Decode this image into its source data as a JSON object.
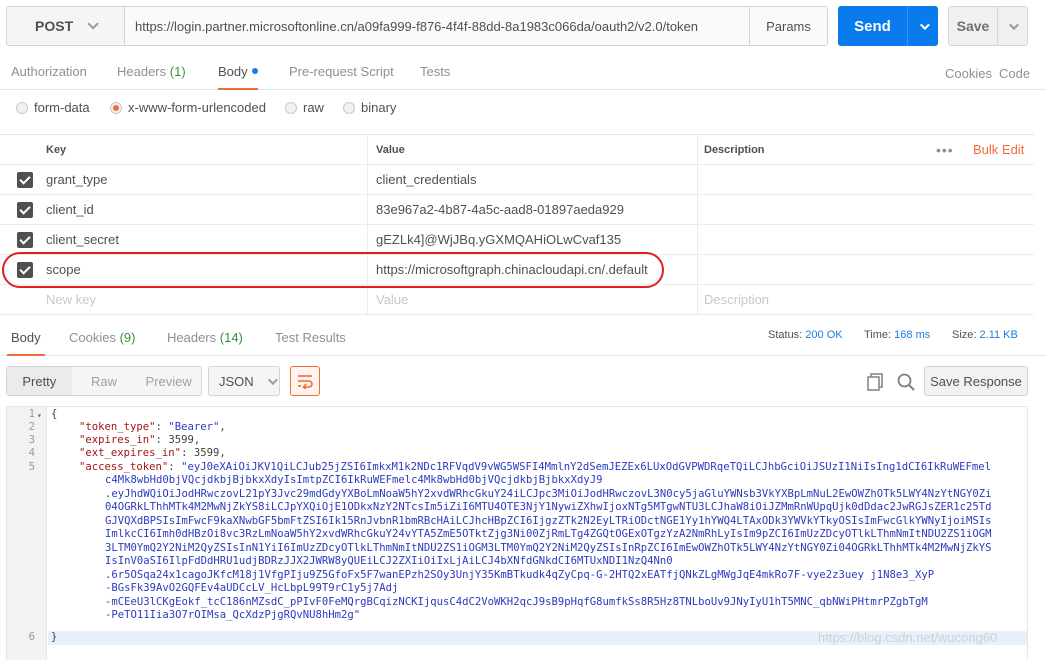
{
  "request": {
    "method": "POST",
    "url": "https://login.partner.microsoftonline.cn/a09fa999-f876-4f4f-88dd-8a1983c066da/oauth2/v2.0/token",
    "params_label": "Params",
    "send_label": "Send",
    "save_label": "Save"
  },
  "req_tabs": {
    "authorization": "Authorization",
    "headers": "Headers",
    "headers_count": "(1)",
    "body": "Body",
    "prerequest": "Pre-request Script",
    "tests": "Tests",
    "cookies": "Cookies",
    "code": "Code"
  },
  "body_types": {
    "form_data": "form-data",
    "urlencoded": "x-www-form-urlencoded",
    "raw": "raw",
    "binary": "binary",
    "selected": "x-www-form-urlencoded"
  },
  "kv_table": {
    "headers": {
      "key": "Key",
      "value": "Value",
      "description": "Description",
      "bulk_edit": "Bulk Edit"
    },
    "rows": [
      {
        "key": "grant_type",
        "value": "client_credentials",
        "checked": true
      },
      {
        "key": "client_id",
        "value": "83e967a2-4b87-4a5c-aad8-01897aeda929",
        "checked": true
      },
      {
        "key": "client_secret",
        "value": "gEZLk4]@WjJBq.yGXMQAHiOLwCvaf135",
        "checked": true
      },
      {
        "key": "scope",
        "value": "https://microsoftgraph.chinacloudapi.cn/.default",
        "checked": true
      }
    ],
    "new_key_placeholder": "New key",
    "value_placeholder": "Value",
    "description_placeholder": "Description"
  },
  "res_tabs": {
    "body": "Body",
    "cookies": "Cookies",
    "cookies_count": "(9)",
    "headers": "Headers",
    "headers_count": "(14)",
    "test_results": "Test Results",
    "status_label": "Status:",
    "status_value": "200 OK",
    "time_label": "Time:",
    "time_value": "168 ms",
    "size_label": "Size:",
    "size_value": "2.11 KB"
  },
  "res_toolbar": {
    "pretty": "Pretty",
    "raw": "Raw",
    "preview": "Preview",
    "format": "JSON",
    "save_response": "Save Response"
  },
  "response": {
    "line_numbers": [
      "1",
      "2",
      "3",
      "4",
      "5",
      "6"
    ],
    "open_brace": "{",
    "close_brace": "}",
    "token_type_key": "\"token_type\"",
    "token_type_val": "\"Bearer\"",
    "expires_in_key": "\"expires_in\"",
    "expires_in_val": "3599",
    "ext_expires_in_key": "\"ext_expires_in\"",
    "ext_expires_in_val": "3599",
    "access_token_key": "\"access_token\"",
    "access_token_lines": [
      "\"eyJ0eXAiOiJKV1QiLCJub25jZSI6ImkxM1k2NDc1RFVqdV9vWG5WSFI4MmlnY2dSemJEZEx6LUxOdGVPWDRqeTQiLCJhbGciOiJSUzI1NiIsIng1dCI6IkRuWEFmel",
      "c4Mk8wbHd0bjVQcjdkbjBjbkxXdyIsImtpZCI6IkRuWEFmelc4Mk8wbHd0bjVQcjdkbjBjbkxXdyJ9",
      ".eyJhdWQiOiJodHRwczovL21pY3Jvc29mdGdyYXBoLmNoaW5hY2xvdWRhcGkuY24iLCJpc3MiOiJodHRwczovL3N0cy5jaGluYWNsb3VkYXBpLmNuL2EwOWZhOTk5LWY4NzYtNGY0Zi",
      "04OGRkLThhMTk4M2MwNjZkYS8iLCJpYXQiOjE1ODkxNzY2NTcsIm5iZiI6MTU4OTE3NjY1NywiZXhwIjoxNTg5MTgwNTU3LCJhaW8iOiJZMmRnWUpqUjk0dDdac2JwRGJsZER1c25Td",
      "GJVQXdBPSIsImFwcF9kaXNwbGF5bmFtZSI6Ik15RnJvbnR1bmRBcHAiLCJhcHBpZCI6IjgzZTk2N2EyLTRiODctNGE1Yy1hYWQ4LTAxODk3YWVkYTkyOSIsImFwcGlkYWNyIjoiMSIs",
      "ImlkcCI6Imh0dHBzOi8vc3RzLmNoaW5hY2xvdWRhcGkuY24vYTA5ZmE5OTktZjg3Ni00ZjRmLTg4ZGQtOGExOTgzYzA2NmRhLyIsIm9pZCI6ImUzZDcyOTlkLThmNmItNDU2ZS1iOGM",
      "3LTM0YmQ2Y2NiM2QyZSIsInN1YiI6ImUzZDcyOTlkLThmNmItNDU2ZS1iOGM3LTM0YmQ2Y2NiM2QyZSIsInRpZCI6ImEwOWZhOTk5LWY4NzYtNGY0Zi04OGRkLThhMTk4M2MwNjZkYS",
      "IsInV0aSI6IlpFdDdHRU1udjBDRzJJX2JWRW8yQUEiLCJ2ZXIiOiIxLjAiLCJ4bXNfdGNkdCI6MTUxNDI1NzQ4Nn0",
      ".6r5OSqa24x1cagoJKfcM18j1VfgPIju9Z5GfoFx5F7wanEPzh2SOy3UnjY35KmBTkudk4qZyCpq-G-2HTQ2xEATfjQNkZLgMWgJqE4mkRo7F-vye2z3uey j1N8e3_XyP",
      "-BGsFk39AvO2GQFEv4aUDCcLV_HcLbpL99T9rC1y5j7Adj",
      "-mCEeU3lCKgEokf_tcC186nMZsdC_pPIvF0FeMQrgBCqizNCKIjqusC4dC2VoWKH2qcJ9sB9pHqfG8umfkSs8R5Hz8TNLboUv9JNyIyU1hT5MNC_qbNWiPHtmrPZgbTgM",
      "-PeTO11Iia3O7rOIMsa_QcXdzPjgRQvNU8hHm2g\""
    ]
  },
  "watermark": "https://blog.csdn.net/wucong60",
  "colors": {
    "accent": "#f26b3a",
    "send": "#097bed",
    "status": "#1a7ee6"
  }
}
